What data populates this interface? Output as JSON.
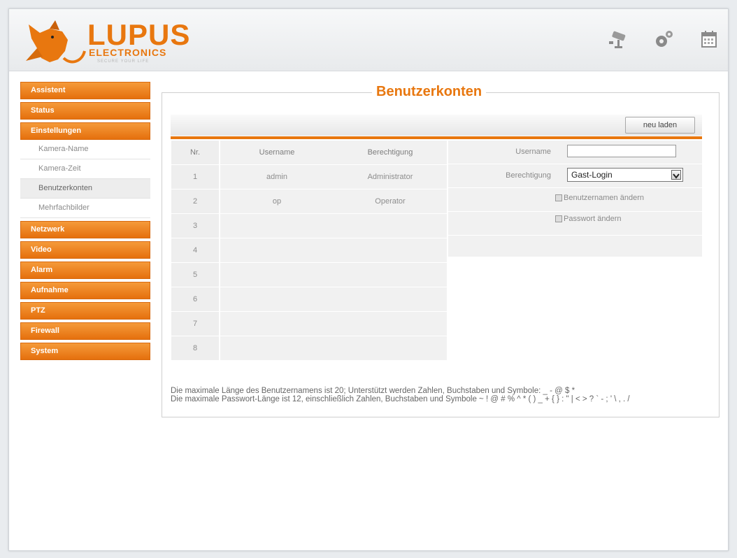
{
  "header": {
    "logo_text": "LUPUS",
    "logo_sub": "ELECTRONICS",
    "logo_tag": "SECURE YOUR LIFE",
    "icons": [
      "camera-icon",
      "gears-icon",
      "calendar-icon"
    ]
  },
  "sidebar": {
    "groups": [
      {
        "label": "Assistent"
      },
      {
        "label": "Status"
      },
      {
        "label": "Einstellungen"
      },
      {
        "label": "Netzwerk"
      },
      {
        "label": "Video"
      },
      {
        "label": "Alarm"
      },
      {
        "label": "Aufnahme"
      },
      {
        "label": "PTZ"
      },
      {
        "label": "Firewall"
      },
      {
        "label": "System"
      }
    ],
    "sub_items": [
      {
        "label": "Kamera-Name"
      },
      {
        "label": "Kamera-Zeit"
      },
      {
        "label": "Benutzerkonten",
        "active": true
      },
      {
        "label": "Mehrfachbilder"
      }
    ]
  },
  "main": {
    "title": "Benutzerkonten",
    "reload_label": "neu laden",
    "table": {
      "headers": {
        "nr": "Nr.",
        "username": "Username",
        "permission": "Berechtigung"
      },
      "rows": [
        {
          "nr": "1",
          "username": "admin",
          "permission": "Administrator"
        },
        {
          "nr": "2",
          "username": "op",
          "permission": "Operator"
        },
        {
          "nr": "3",
          "username": "",
          "permission": ""
        },
        {
          "nr": "4",
          "username": "",
          "permission": ""
        },
        {
          "nr": "5",
          "username": "",
          "permission": ""
        },
        {
          "nr": "6",
          "username": "",
          "permission": ""
        },
        {
          "nr": "7",
          "username": "",
          "permission": ""
        },
        {
          "nr": "8",
          "username": "",
          "permission": ""
        }
      ]
    },
    "form": {
      "username_label": "Username",
      "username_value": "",
      "permission_label": "Berechtigung",
      "permission_value": "Gast-Login",
      "change_username_label": "Benutzernamen ändern",
      "change_password_label": "Passwort ändern"
    },
    "info": {
      "line1": "Die maximale Länge des Benutzernamens ist 20; Unterstützt werden Zahlen, Buchstaben und Symbole: _ - @ $ *",
      "line2": "Die maximale Passwort-Länge ist 12, einschließlich Zahlen, Buchstaben und Symbole ~ ! @ # % ^ * ( ) _ + { } : \" | < > ? ` - ; ' \\ , . /"
    }
  },
  "colors": {
    "accent": "#e8770f",
    "nav_gradient_top": "#f59a3a",
    "nav_gradient_bottom": "#e5700d"
  }
}
